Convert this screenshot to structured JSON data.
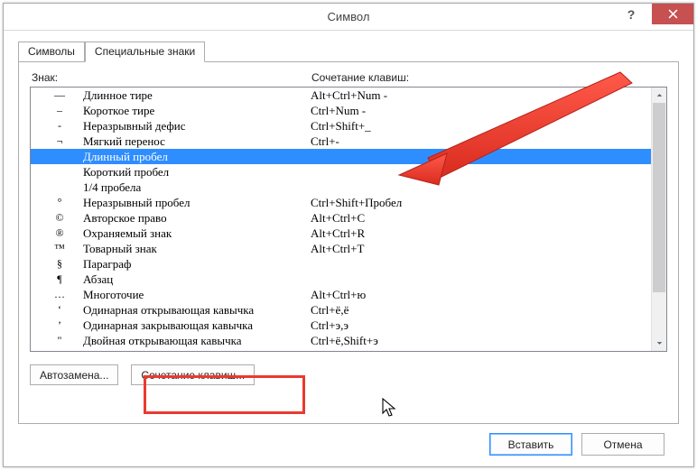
{
  "window": {
    "title": "Символ"
  },
  "tabs": {
    "symbols": "Символы",
    "special": "Специальные знаки"
  },
  "headers": {
    "sign": "Знак:",
    "keys": "Сочетание клавиш:"
  },
  "rows": [
    {
      "sym": "—",
      "name": "Длинное тире",
      "keys": "Alt+Ctrl+Num -",
      "selected": false
    },
    {
      "sym": "–",
      "name": "Короткое тире",
      "keys": "Ctrl+Num -",
      "selected": false
    },
    {
      "sym": "-",
      "name": "Неразрывный дефис",
      "keys": "Ctrl+Shift+_",
      "selected": false
    },
    {
      "sym": "¬",
      "name": "Мягкий перенос",
      "keys": "Ctrl+-",
      "selected": false
    },
    {
      "sym": "",
      "name": "Длинный пробел",
      "keys": "",
      "selected": true
    },
    {
      "sym": "",
      "name": "Короткий пробел",
      "keys": "",
      "selected": false
    },
    {
      "sym": "",
      "name": "1/4 пробела",
      "keys": "",
      "selected": false
    },
    {
      "sym": "°",
      "name": "Неразрывный пробел",
      "keys": "Ctrl+Shift+Пробел",
      "selected": false
    },
    {
      "sym": "©",
      "name": "Авторское право",
      "keys": "Alt+Ctrl+C",
      "selected": false
    },
    {
      "sym": "®",
      "name": "Охраняемый знак",
      "keys": "Alt+Ctrl+R",
      "selected": false
    },
    {
      "sym": "™",
      "name": "Товарный знак",
      "keys": "Alt+Ctrl+T",
      "selected": false
    },
    {
      "sym": "§",
      "name": "Параграф",
      "keys": "",
      "selected": false
    },
    {
      "sym": "¶",
      "name": "Абзац",
      "keys": "",
      "selected": false
    },
    {
      "sym": "…",
      "name": "Многоточие",
      "keys": "Alt+Ctrl+ю",
      "selected": false
    },
    {
      "sym": "‘",
      "name": "Одинарная открывающая кавычка",
      "keys": "Ctrl+ё,ё",
      "selected": false
    },
    {
      "sym": "’",
      "name": "Одинарная закрывающая кавычка",
      "keys": "Ctrl+э,э",
      "selected": false
    },
    {
      "sym": "\"",
      "name": "Двойная открывающая кавычка",
      "keys": "Ctrl+ё,Shift+э",
      "selected": false
    }
  ],
  "buttons": {
    "autocorrect": "Автозамена...",
    "shortcut": "Сочетание клавиш...",
    "insert": "Вставить",
    "cancel": "Отмена"
  },
  "annotations": {
    "arrow_color": "#ea3a2f",
    "highlight_color": "#ea3a2f"
  }
}
